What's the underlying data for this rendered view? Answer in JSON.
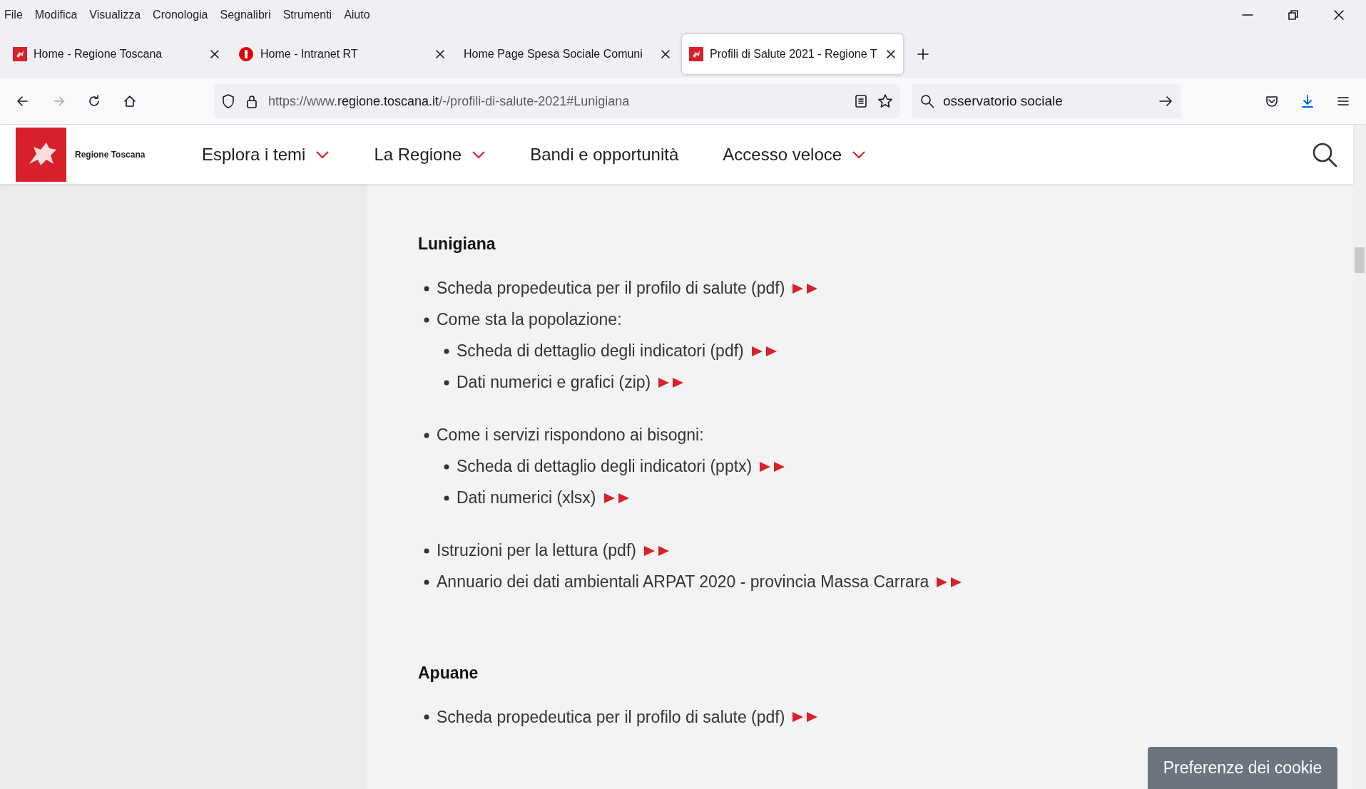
{
  "menu_bar": [
    "File",
    "Modifica",
    "Visualizza",
    "Cronologia",
    "Segnalibri",
    "Strumenti",
    "Aiuto"
  ],
  "tabs": [
    {
      "title": "Home - Regione Toscana",
      "kind": "regione",
      "selected": false
    },
    {
      "title": "Home - Intranet RT",
      "kind": "intranet",
      "selected": false
    },
    {
      "title": "Home Page Spesa Sociale Comuni",
      "kind": "plain",
      "selected": false
    },
    {
      "title": "Profili di Salute 2021 - Regione T",
      "kind": "regione",
      "selected": true
    }
  ],
  "address_bar": {
    "prefix": "https://www.",
    "domain": "regione.toscana.it",
    "path": "/-/profili-di-salute-2021#Lunigiana"
  },
  "search_field": {
    "value": "osservatorio sociale"
  },
  "site_header": {
    "logo_text": "Regione Toscana",
    "nav": [
      {
        "label": "Esplora i temi",
        "dropdown": true
      },
      {
        "label": "La Regione",
        "dropdown": true
      },
      {
        "label": "Bandi e opportunità",
        "dropdown": false
      },
      {
        "label": "Accesso veloce",
        "dropdown": true
      }
    ]
  },
  "sections": [
    {
      "heading": "Lunigiana",
      "items": [
        {
          "text": "Scheda propedeutica per il profilo di salute  (pdf)",
          "link": true
        },
        {
          "text": "Come sta la popolazione:",
          "link": false,
          "children": [
            {
              "text": "Scheda di dettaglio degli indicatori (pdf)",
              "link": true
            },
            {
              "text": "Dati numerici e grafici (zip)",
              "link": true
            }
          ]
        },
        {
          "text": "Come i servizi rispondono ai bisogni:",
          "link": false,
          "children": [
            {
              "text": "Scheda di dettaglio degli indicatori (pptx)",
              "link": true
            },
            {
              "text": "Dati numerici (xlsx)",
              "link": true
            }
          ]
        },
        {
          "text": "Istruzioni per la lettura (pdf)",
          "link": true
        },
        {
          "text": "Annuario dei dati ambientali ARPAT 2020 - provincia Massa Carrara",
          "link": true
        }
      ]
    },
    {
      "heading": "Apuane",
      "items": [
        {
          "text": "Scheda propedeutica per il profilo di salute (pdf)",
          "link": true
        }
      ]
    }
  ],
  "cookie_button": "Preferenze dei cookie"
}
